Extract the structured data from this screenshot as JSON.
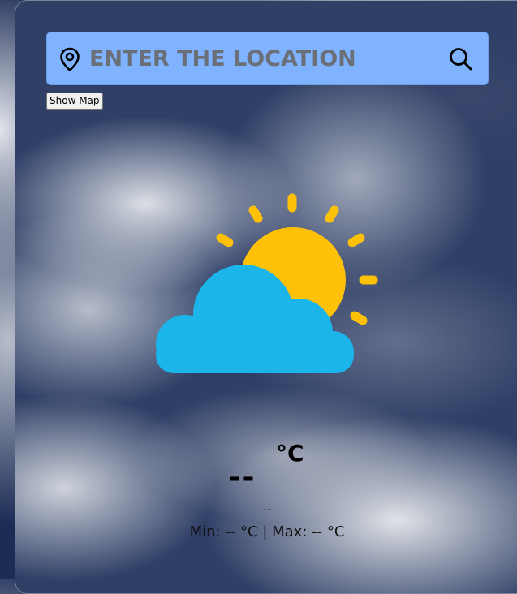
{
  "search": {
    "placeholder": "ENTER THE LOCATION",
    "value": ""
  },
  "map_button": {
    "label": "Show Map"
  },
  "weather": {
    "icon": "partly-cloudy-icon",
    "temperature": "--",
    "unit": "°C",
    "description": "--",
    "minmax": "Min: -- °C | Max: -- °C"
  },
  "colors": {
    "search_bg": "#80b3ff",
    "sun": "#ffc107",
    "cloud": "#1bb5ea"
  }
}
